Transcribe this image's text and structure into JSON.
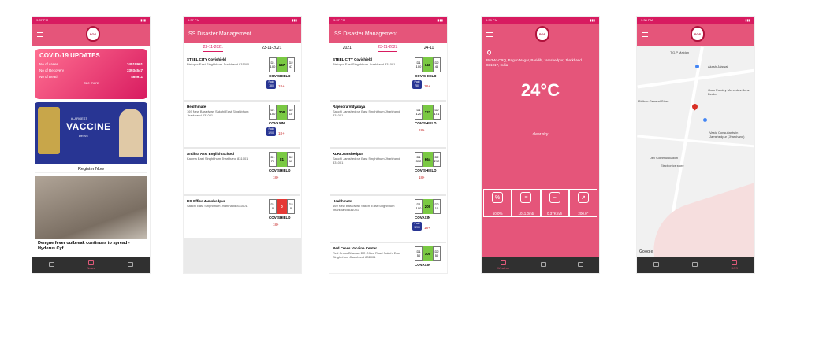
{
  "phone1": {
    "covid": {
      "title": "COVID-19 UPDATES",
      "rows": [
        {
          "label": "No of cases",
          "value": "34518901"
        },
        {
          "label": "No of Recovery",
          "value": "33934547"
        },
        {
          "label": "No of Death",
          "value": "465911"
        }
      ],
      "see_more": "See more"
    },
    "vaccine_banner": {
      "line1": "#LARGEST",
      "line2": "VACCINE",
      "line3": "DRIVE"
    },
    "register": "Register Now",
    "news_caption": "Dengue fever outbreak continues to spread - Hyderus Cyf",
    "nav": [
      "",
      "News",
      ""
    ]
  },
  "phone2": {
    "title": "SS Disaster Management",
    "tabs": [
      "22-11-2021",
      "23-11-2021"
    ],
    "cards": [
      {
        "name": "STEEL CITY Covishield",
        "address": "Bistupur East Singhbhum Jharkhand 831001",
        "d1": "D1 100",
        "avail": "147",
        "d2": "D2 47",
        "vaccine": "COVISHIELD",
        "paid": "Paid 780",
        "age": "18+",
        "color": "#7ac943"
      },
      {
        "name": "Healthmate",
        "address": "169 New Baradwari Sakchi East Singhbhum Jharkhand 831001",
        "d1": "D1 100",
        "avail": "200",
        "d2": "D2 10",
        "vaccine": "COVAXIN",
        "paid": "Paid 1200",
        "age": "18+",
        "color": "#7ac943"
      },
      {
        "name": "Andhra Ass. English School",
        "address": "Kadma East Singhbhum Jharkhand 831001",
        "d1": "D1 70",
        "avail": "81",
        "d2": "D2 11",
        "vaccine": "COVISHIELD",
        "paid": "",
        "age": "18+",
        "color": "#7ac943"
      },
      {
        "name": "DC Office Jamshedpur",
        "address": "Sakchi East Singhbhum Jharkhand 831001",
        "d1": "D1 0",
        "avail": "0",
        "d2": "D2 0",
        "vaccine": "COVISHIELD",
        "paid": "",
        "age": "18+",
        "color": "#e53935"
      }
    ]
  },
  "phone3": {
    "title": "SS Disaster Management",
    "tabs": [
      "2021",
      "23-11-2021",
      "24-11"
    ],
    "cards": [
      {
        "name": "STEEL CITY Covishield",
        "address": "Bistupur East Singhbhum Jharkhand 831001",
        "d1": "D1 100",
        "avail": "146",
        "d2": "D2 46",
        "vaccine": "COVISHIELD",
        "paid": "Paid 780",
        "age": "18+",
        "color": "#7ac943"
      },
      {
        "name": "Rajendra Vidyalaya",
        "address": "Sakchi Jamshedpur East Singhbhum Jharkhand 831001",
        "d1": "D1 120",
        "avail": "221",
        "d2": "D2 101",
        "vaccine": "COVISHIELD",
        "paid": "",
        "age": "18+",
        "color": "#7ac943"
      },
      {
        "name": "XLRI Jamshedpur",
        "address": "Sakchi Jamshedpur East Singhbhum Jharkhand 831001",
        "d1": "D1 372",
        "avail": "664",
        "d2": "D2 292",
        "vaccine": "COVISHIELD",
        "paid": "",
        "age": "18+",
        "color": "#7ac943"
      },
      {
        "name": "Healthmate",
        "address": "169 New Baradwari Sakchi East Singhbhum Jharkhand 831001",
        "d1": "D1 100",
        "avail": "200",
        "d2": "D2 10",
        "vaccine": "COVAXIN",
        "paid": "Paid 1200",
        "age": "18+",
        "color": "#7ac943"
      },
      {
        "name": "Red Cross Vaccine Center",
        "address": "Red Cross Bhawan DC Office Road Sakchi East Singhbhum Jharkhand 831001",
        "d1": "D1 50",
        "avail": "100",
        "d2": "D2 50",
        "vaccine": "COVAXIN",
        "paid": "",
        "age": "",
        "color": "#7ac943"
      }
    ]
  },
  "phone4": {
    "address": "R63W+CRQ, Bagun Nagar, Baridih, Jamshedpur, Jharkhand 831017, India",
    "temperature": "24°C",
    "condition": "clear sky",
    "stats": [
      {
        "icon": "humidity-icon",
        "glyph": "%",
        "value": "50.0%"
      },
      {
        "icon": "pressure-icon",
        "glyph": "≡",
        "value": "1011.0mb"
      },
      {
        "icon": "wind-icon",
        "glyph": "~",
        "value": "0.37Km/h"
      },
      {
        "icon": "wind-direction-icon",
        "glyph": "↗",
        "value": "200.0°"
      }
    ],
    "nav": [
      "Weather",
      "",
      ""
    ]
  },
  "phone5": {
    "labels": [
      "T.G.P Maidan",
      "Akash Jaiswal",
      "Goru Pandey Mercedes-Benz Dealer",
      "Bidhan General Store",
      "Vastu Consultants in Jamshedpur (Jharkhand)",
      "Dev Communication",
      "Electronics store",
      "Google"
    ],
    "nav": [
      "",
      "",
      "SOS"
    ]
  },
  "colors": {
    "brand": "#e5557a",
    "statusbar": "#d81b60",
    "nav": "#303030"
  }
}
